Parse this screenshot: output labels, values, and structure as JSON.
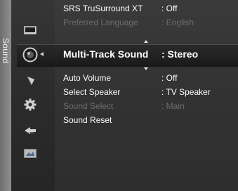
{
  "side_label": "Sound",
  "menu": {
    "items": [
      {
        "label": "SRS TruSurround XT",
        "value": ": Off",
        "state": "normal"
      },
      {
        "label": "Preferred Language",
        "value": ": English",
        "state": "disabled"
      },
      {
        "label": "Multi-Track Sound",
        "value": ": Stereo",
        "state": "selected"
      },
      {
        "label": "Auto Volume",
        "value": ": Off",
        "state": "normal"
      },
      {
        "label": "Select Speaker",
        "value": ": TV Speaker",
        "state": "normal"
      },
      {
        "label": "Sound Select",
        "value": ": Main",
        "state": "disabled"
      },
      {
        "label": "Sound Reset",
        "value": "",
        "state": "normal"
      }
    ]
  },
  "icons": [
    "picture-icon",
    "sound-icon",
    "channel-icon",
    "setup-icon",
    "input-icon",
    "application-icon"
  ],
  "colors": {
    "text": "#ffffff",
    "disabled": "#6c6c6c",
    "panel": "#333333",
    "side_tab": "#7a7a7a"
  }
}
